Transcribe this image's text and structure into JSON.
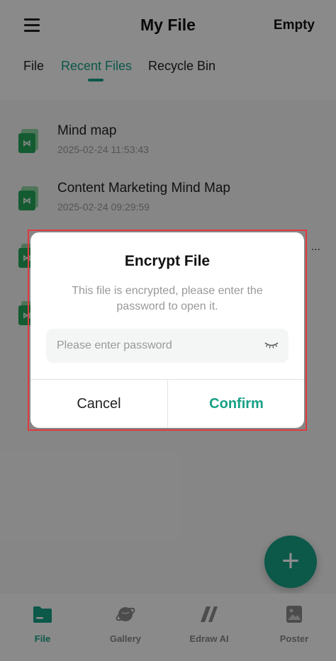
{
  "header": {
    "title": "My File",
    "empty_label": "Empty",
    "tabs": [
      {
        "label": "File",
        "active": false
      },
      {
        "label": "Recent Files",
        "active": true
      },
      {
        "label": "Recycle Bin",
        "active": false
      }
    ]
  },
  "files": [
    {
      "name": "Mind map",
      "date": "2025-02-24 11:53:43"
    },
    {
      "name": "Content Marketing Mind Map",
      "date": "2025-02-24 09:29:59"
    }
  ],
  "file_icon_glyph": "⋈",
  "more_glyph": "...",
  "dialog": {
    "title": "Encrypt File",
    "message": "This file is encrypted, please enter the password to open it.",
    "password_placeholder": "Please enter password",
    "password_value": "",
    "cancel_label": "Cancel",
    "confirm_label": "Confirm"
  },
  "fab": {
    "label": "+"
  },
  "bottom_nav": [
    {
      "label": "File",
      "icon": "folder-icon",
      "active": true
    },
    {
      "label": "Gallery",
      "icon": "planet-icon",
      "active": false
    },
    {
      "label": "Edraw AI",
      "icon": "edraw-ai-icon",
      "active": false
    },
    {
      "label": "Poster",
      "icon": "poster-icon",
      "active": false
    }
  ],
  "colors": {
    "accent": "#16a085",
    "highlight_border": "#e0393e",
    "file_icon": "#26a65b"
  }
}
